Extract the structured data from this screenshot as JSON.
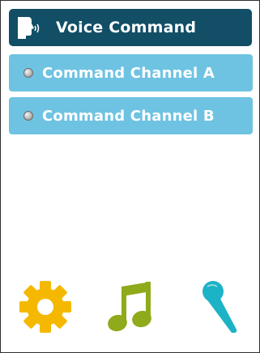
{
  "header": {
    "title": "Voice Command",
    "icon": "voice-speaking-icon"
  },
  "channels": [
    {
      "label": "Command Channel A",
      "selected": false
    },
    {
      "label": "Command Channel B",
      "selected": false
    }
  ],
  "bottom_icons": [
    {
      "name": "settings",
      "icon": "gear-icon",
      "color": "#f5b800"
    },
    {
      "name": "music",
      "icon": "music-note-icon",
      "color": "#8faa1a"
    },
    {
      "name": "microphone",
      "icon": "microphone-icon",
      "color": "#1db3c7"
    }
  ],
  "colors": {
    "header_bg": "#124f66",
    "channel_bg": "#6fc3e2",
    "text": "#ffffff"
  }
}
